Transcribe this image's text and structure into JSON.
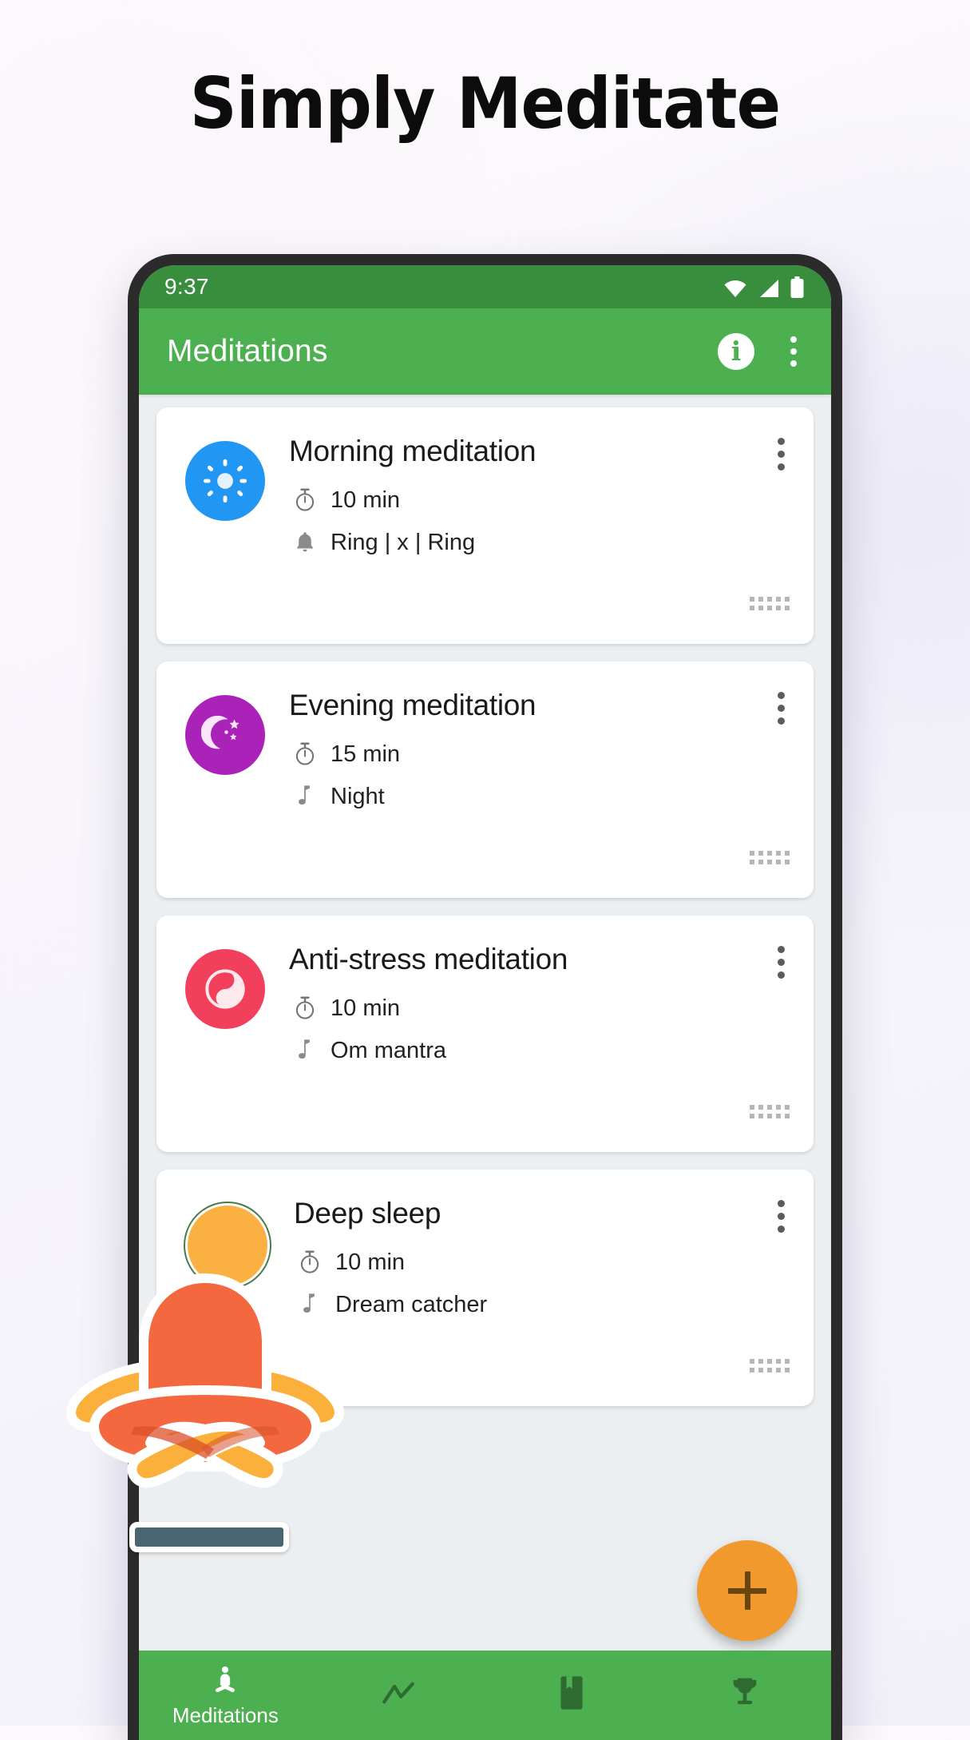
{
  "headline": "Simply Meditate",
  "theme": {
    "status_bar_green": "#388e3c",
    "app_bar_green": "#4caf50",
    "fab_orange": "#f2992e",
    "screen_bg": "#eceff1"
  },
  "status_bar": {
    "time": "9:37",
    "icons": [
      "wifi-icon",
      "cell-signal-icon",
      "battery-icon"
    ]
  },
  "app_bar": {
    "title": "Meditations",
    "info_label": "i",
    "info_icon": "info-icon",
    "overflow_icon": "overflow-menu-icon"
  },
  "meditations": [
    {
      "title": "Morning meditation",
      "duration": "10 min",
      "sound": "Ring | x | Ring",
      "avatar_color": "#2196f3",
      "avatar_icon": "sun-icon",
      "sound_icon": "bell-icon",
      "duration_icon": "stopwatch-icon"
    },
    {
      "title": "Evening meditation",
      "duration": "15 min",
      "sound": "Night",
      "avatar_color": "#aa22b8",
      "avatar_icon": "moon-stars-icon",
      "sound_icon": "music-note-icon",
      "duration_icon": "stopwatch-icon"
    },
    {
      "title": "Anti-stress meditation",
      "duration": "10 min",
      "sound": "Om mantra",
      "avatar_color": "#f2405c",
      "avatar_icon": "yin-yang-icon",
      "sound_icon": "music-note-icon",
      "duration_icon": "stopwatch-icon"
    },
    {
      "title": "Deep sleep",
      "duration": "10 min",
      "sound": "Dream catcher",
      "avatar_color": "#fab142",
      "avatar_icon": "circle-icon",
      "sound_icon": "music-note-icon",
      "duration_icon": "stopwatch-icon"
    }
  ],
  "fab": {
    "icon": "plus-icon",
    "label": "+"
  },
  "bottom_nav": [
    {
      "label": "Meditations",
      "icon": "meditating-person-icon",
      "active": true
    },
    {
      "label": "",
      "icon": "trend-chart-icon",
      "active": false
    },
    {
      "label": "",
      "icon": "book-icon",
      "active": false
    },
    {
      "label": "",
      "icon": "trophy-icon",
      "active": false
    }
  ],
  "mascot": {
    "icon": "meditating-figure-illustration"
  }
}
